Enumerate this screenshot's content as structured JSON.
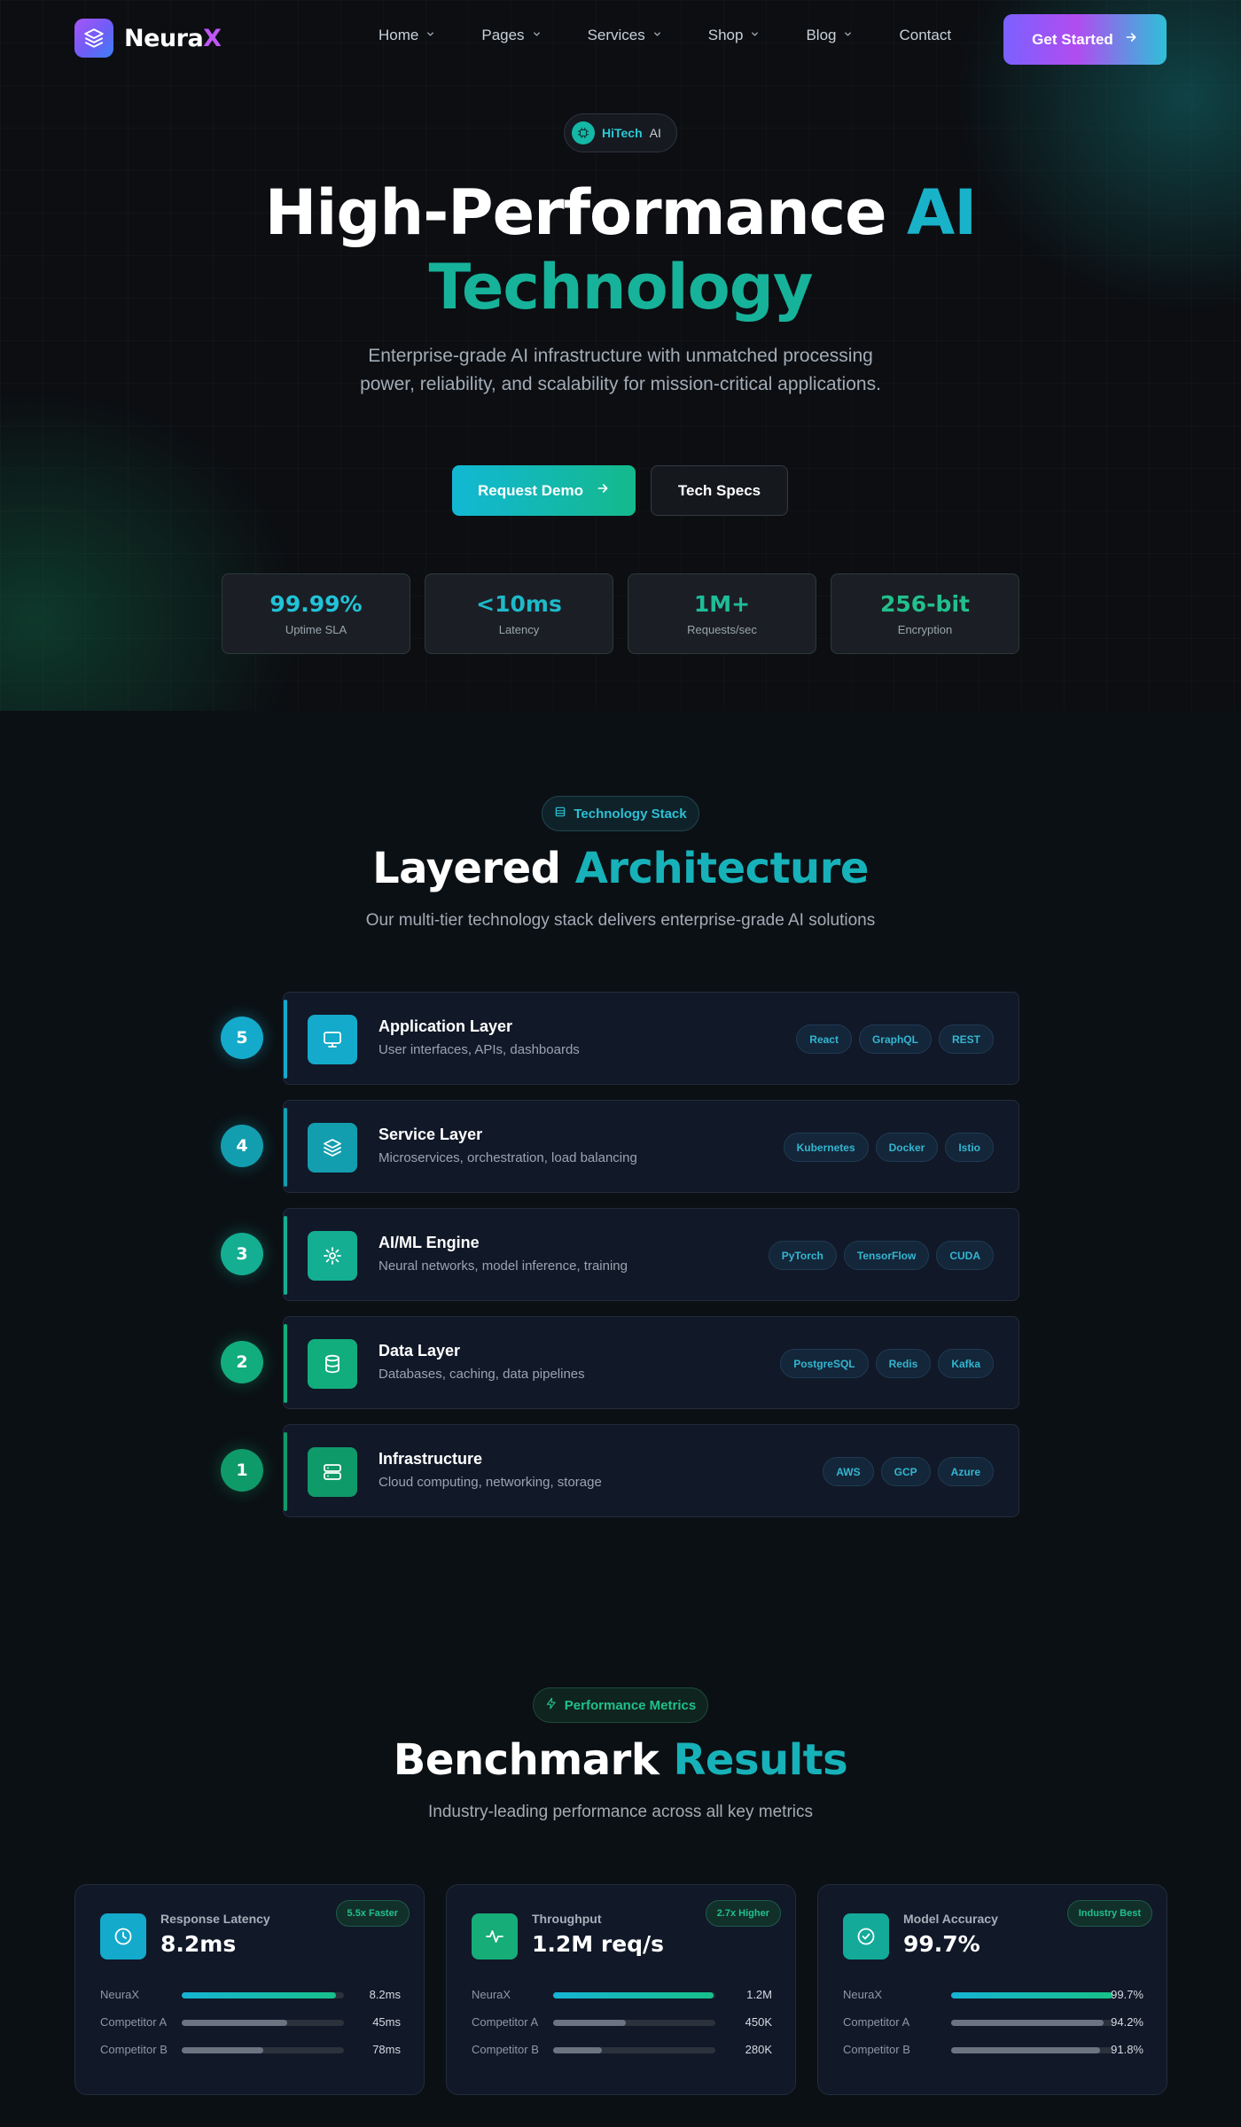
{
  "brand": {
    "name_main": "Neura",
    "name_accent": "X"
  },
  "nav": {
    "items": [
      {
        "label": "Home",
        "dropdown": true
      },
      {
        "label": "Pages",
        "dropdown": true
      },
      {
        "label": "Services",
        "dropdown": true
      },
      {
        "label": "Shop",
        "dropdown": true
      },
      {
        "label": "Blog",
        "dropdown": true
      },
      {
        "label": "Contact",
        "dropdown": false
      }
    ],
    "cta_label": "Get Started"
  },
  "hero": {
    "badge_primary": "HiTech",
    "badge_secondary": "AI",
    "title_part1": "High-Performance ",
    "title_accent1": "AI",
    "title_accent2": "Technology",
    "subtitle": "Enterprise-grade AI infrastructure with unmatched processing power, reliability, and scalability for mission-critical applications.",
    "primary_button": "Request Demo",
    "secondary_button": "Tech Specs",
    "stats": [
      {
        "value": "99.99%",
        "label": "Uptime SLA",
        "color": "#22c3d8"
      },
      {
        "value": "<10ms",
        "label": "Latency",
        "color": "#1eb9c9"
      },
      {
        "value": "1M+",
        "label": "Requests/sec",
        "color": "#1fbc98"
      },
      {
        "value": "256-bit",
        "label": "Encryption",
        "color": "#22c08c"
      }
    ]
  },
  "architecture": {
    "badge": "Technology Stack",
    "title_main": "Layered ",
    "title_accent": "Architecture",
    "subtitle": "Our multi-tier technology stack delivers enterprise-grade AI solutions",
    "layers": [
      {
        "number": "5",
        "title": "Application Layer",
        "description": "User interfaces, APIs, dashboards",
        "icon": "monitor-icon",
        "color": "#14aacb",
        "tags": [
          "React",
          "GraphQL",
          "REST"
        ]
      },
      {
        "number": "4",
        "title": "Service Layer",
        "description": "Microservices, orchestration, load balancing",
        "icon": "layers-icon",
        "color": "#129eaf",
        "tags": [
          "Kubernetes",
          "Docker",
          "Istio"
        ]
      },
      {
        "number": "3",
        "title": "AI/ML Engine",
        "description": "Neural networks, model inference, training",
        "icon": "cpu-spark-icon",
        "color": "#14ae92",
        "tags": [
          "PyTorch",
          "TensorFlow",
          "CUDA"
        ]
      },
      {
        "number": "2",
        "title": "Data Layer",
        "description": "Databases, caching, data pipelines",
        "icon": "database-icon",
        "color": "#12ad7c",
        "tags": [
          "PostgreSQL",
          "Redis",
          "Kafka"
        ]
      },
      {
        "number": "1",
        "title": "Infrastructure",
        "description": "Cloud computing, networking, storage",
        "icon": "server-icon",
        "color": "#0f9a6a",
        "tags": [
          "AWS",
          "GCP",
          "Azure"
        ]
      }
    ]
  },
  "benchmarks": {
    "badge": "Performance Metrics",
    "title_main": "Benchmark ",
    "title_accent": "Results",
    "subtitle": "Industry-leading performance across all key metrics",
    "cards": [
      {
        "label": "Response Latency",
        "value": "8.2ms",
        "badge": "5.5x Faster",
        "icon": "clock-icon",
        "icon_color": "#14aacb",
        "rows": [
          {
            "name": "NeuraX",
            "value": "8.2ms",
            "fill": 0.95,
            "highlight": true
          },
          {
            "name": "Competitor A",
            "value": "45ms",
            "fill": 0.65,
            "highlight": false
          },
          {
            "name": "Competitor B",
            "value": "78ms",
            "fill": 0.5,
            "highlight": false
          }
        ]
      },
      {
        "label": "Throughput",
        "value": "1.2M req/s",
        "badge": "2.7x Higher",
        "icon": "activity-icon",
        "icon_color": "#16ad78",
        "rows": [
          {
            "name": "NeuraX",
            "value": "1.2M",
            "fill": 0.99,
            "highlight": true
          },
          {
            "name": "Competitor A",
            "value": "450K",
            "fill": 0.45,
            "highlight": false
          },
          {
            "name": "Competitor B",
            "value": "280K",
            "fill": 0.3,
            "highlight": false
          }
        ]
      },
      {
        "label": "Model Accuracy",
        "value": "99.7%",
        "badge": "Industry Best",
        "icon": "check-circle-icon",
        "icon_color": "#13aa9a",
        "rows": [
          {
            "name": "NeuraX",
            "value": "99.7%",
            "fill": 0.997,
            "highlight": true
          },
          {
            "name": "Competitor A",
            "value": "94.2%",
            "fill": 0.942,
            "highlight": false
          },
          {
            "name": "Competitor B",
            "value": "91.8%",
            "fill": 0.918,
            "highlight": false
          }
        ]
      }
    ]
  }
}
